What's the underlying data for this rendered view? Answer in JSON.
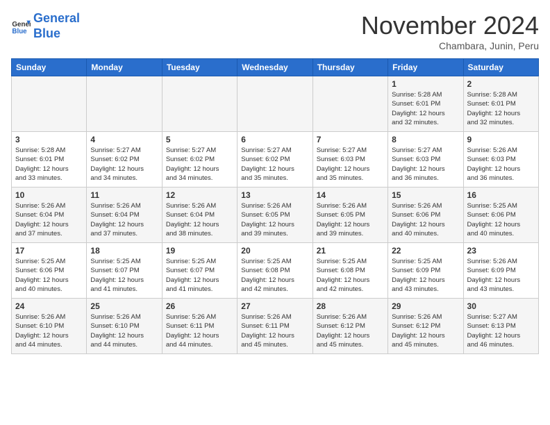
{
  "header": {
    "logo_line1": "General",
    "logo_line2": "Blue",
    "month": "November 2024",
    "location": "Chambara, Junin, Peru"
  },
  "weekdays": [
    "Sunday",
    "Monday",
    "Tuesday",
    "Wednesday",
    "Thursday",
    "Friday",
    "Saturday"
  ],
  "weeks": [
    [
      {
        "day": "",
        "info": ""
      },
      {
        "day": "",
        "info": ""
      },
      {
        "day": "",
        "info": ""
      },
      {
        "day": "",
        "info": ""
      },
      {
        "day": "",
        "info": ""
      },
      {
        "day": "1",
        "info": "Sunrise: 5:28 AM\nSunset: 6:01 PM\nDaylight: 12 hours\nand 32 minutes."
      },
      {
        "day": "2",
        "info": "Sunrise: 5:28 AM\nSunset: 6:01 PM\nDaylight: 12 hours\nand 32 minutes."
      }
    ],
    [
      {
        "day": "3",
        "info": "Sunrise: 5:28 AM\nSunset: 6:01 PM\nDaylight: 12 hours\nand 33 minutes."
      },
      {
        "day": "4",
        "info": "Sunrise: 5:27 AM\nSunset: 6:02 PM\nDaylight: 12 hours\nand 34 minutes."
      },
      {
        "day": "5",
        "info": "Sunrise: 5:27 AM\nSunset: 6:02 PM\nDaylight: 12 hours\nand 34 minutes."
      },
      {
        "day": "6",
        "info": "Sunrise: 5:27 AM\nSunset: 6:02 PM\nDaylight: 12 hours\nand 35 minutes."
      },
      {
        "day": "7",
        "info": "Sunrise: 5:27 AM\nSunset: 6:03 PM\nDaylight: 12 hours\nand 35 minutes."
      },
      {
        "day": "8",
        "info": "Sunrise: 5:27 AM\nSunset: 6:03 PM\nDaylight: 12 hours\nand 36 minutes."
      },
      {
        "day": "9",
        "info": "Sunrise: 5:26 AM\nSunset: 6:03 PM\nDaylight: 12 hours\nand 36 minutes."
      }
    ],
    [
      {
        "day": "10",
        "info": "Sunrise: 5:26 AM\nSunset: 6:04 PM\nDaylight: 12 hours\nand 37 minutes."
      },
      {
        "day": "11",
        "info": "Sunrise: 5:26 AM\nSunset: 6:04 PM\nDaylight: 12 hours\nand 37 minutes."
      },
      {
        "day": "12",
        "info": "Sunrise: 5:26 AM\nSunset: 6:04 PM\nDaylight: 12 hours\nand 38 minutes."
      },
      {
        "day": "13",
        "info": "Sunrise: 5:26 AM\nSunset: 6:05 PM\nDaylight: 12 hours\nand 39 minutes."
      },
      {
        "day": "14",
        "info": "Sunrise: 5:26 AM\nSunset: 6:05 PM\nDaylight: 12 hours\nand 39 minutes."
      },
      {
        "day": "15",
        "info": "Sunrise: 5:26 AM\nSunset: 6:06 PM\nDaylight: 12 hours\nand 40 minutes."
      },
      {
        "day": "16",
        "info": "Sunrise: 5:25 AM\nSunset: 6:06 PM\nDaylight: 12 hours\nand 40 minutes."
      }
    ],
    [
      {
        "day": "17",
        "info": "Sunrise: 5:25 AM\nSunset: 6:06 PM\nDaylight: 12 hours\nand 40 minutes."
      },
      {
        "day": "18",
        "info": "Sunrise: 5:25 AM\nSunset: 6:07 PM\nDaylight: 12 hours\nand 41 minutes."
      },
      {
        "day": "19",
        "info": "Sunrise: 5:25 AM\nSunset: 6:07 PM\nDaylight: 12 hours\nand 41 minutes."
      },
      {
        "day": "20",
        "info": "Sunrise: 5:25 AM\nSunset: 6:08 PM\nDaylight: 12 hours\nand 42 minutes."
      },
      {
        "day": "21",
        "info": "Sunrise: 5:25 AM\nSunset: 6:08 PM\nDaylight: 12 hours\nand 42 minutes."
      },
      {
        "day": "22",
        "info": "Sunrise: 5:25 AM\nSunset: 6:09 PM\nDaylight: 12 hours\nand 43 minutes."
      },
      {
        "day": "23",
        "info": "Sunrise: 5:26 AM\nSunset: 6:09 PM\nDaylight: 12 hours\nand 43 minutes."
      }
    ],
    [
      {
        "day": "24",
        "info": "Sunrise: 5:26 AM\nSunset: 6:10 PM\nDaylight: 12 hours\nand 44 minutes."
      },
      {
        "day": "25",
        "info": "Sunrise: 5:26 AM\nSunset: 6:10 PM\nDaylight: 12 hours\nand 44 minutes."
      },
      {
        "day": "26",
        "info": "Sunrise: 5:26 AM\nSunset: 6:11 PM\nDaylight: 12 hours\nand 44 minutes."
      },
      {
        "day": "27",
        "info": "Sunrise: 5:26 AM\nSunset: 6:11 PM\nDaylight: 12 hours\nand 45 minutes."
      },
      {
        "day": "28",
        "info": "Sunrise: 5:26 AM\nSunset: 6:12 PM\nDaylight: 12 hours\nand 45 minutes."
      },
      {
        "day": "29",
        "info": "Sunrise: 5:26 AM\nSunset: 6:12 PM\nDaylight: 12 hours\nand 45 minutes."
      },
      {
        "day": "30",
        "info": "Sunrise: 5:27 AM\nSunset: 6:13 PM\nDaylight: 12 hours\nand 46 minutes."
      }
    ]
  ]
}
